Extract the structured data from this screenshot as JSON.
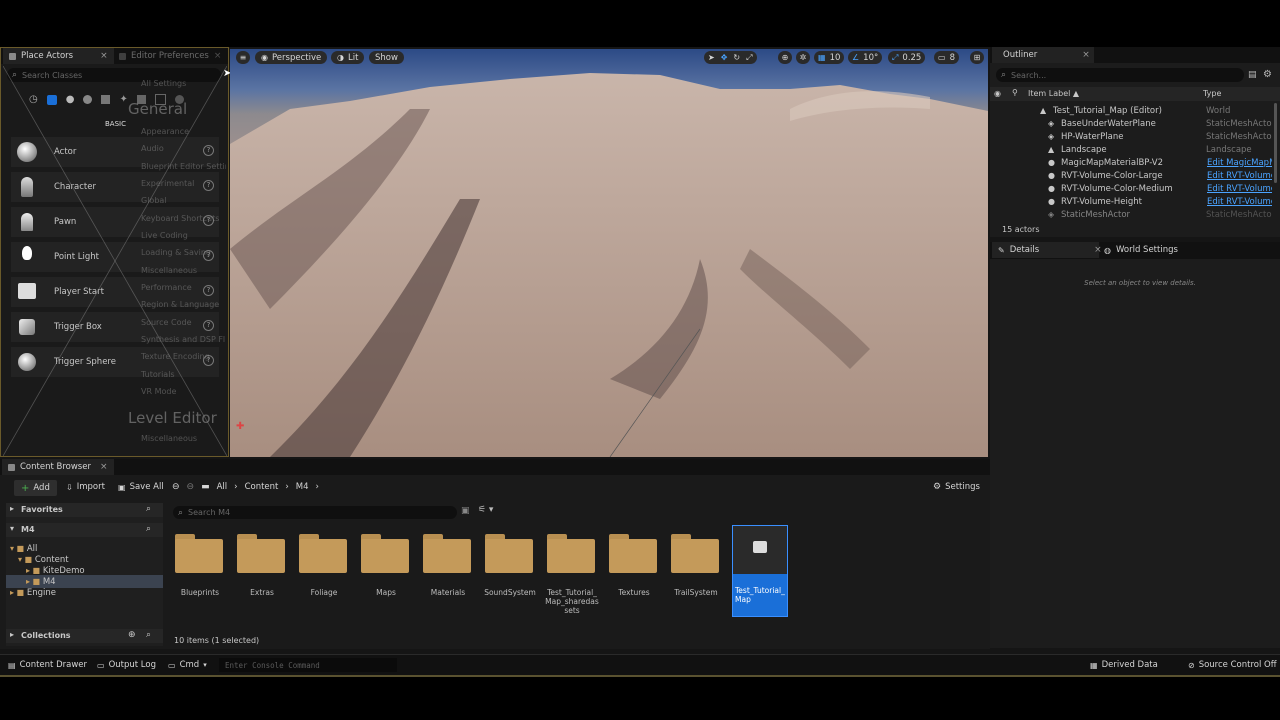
{
  "place_actors": {
    "tab_label": "Place Actors",
    "search_placeholder": "Search Classes",
    "category_label": "BASIC",
    "items": [
      {
        "label": "Actor"
      },
      {
        "label": "Character"
      },
      {
        "label": "Pawn"
      },
      {
        "label": "Point Light"
      },
      {
        "label": "Player Start"
      },
      {
        "label": "Trigger Box"
      },
      {
        "label": "Trigger Sphere"
      }
    ]
  },
  "editor_prefs": {
    "tab_label": "Editor Preferences",
    "all_settings": "All Settings",
    "general_heading": "General",
    "level_editor_heading": "Level Editor",
    "items": [
      "Appearance",
      "Audio",
      "Blueprint Editor Settings",
      "Experimental",
      "Global",
      "Keyboard Shortcuts",
      "Live Coding",
      "Loading & Saving",
      "Miscellaneous",
      "Performance",
      "Region & Language",
      "Source Code",
      "Synthesis and DSP Fl",
      "Texture Encoding",
      "Tutorials",
      "VR Mode"
    ],
    "misc": "Miscellaneous"
  },
  "viewport": {
    "perspective": "Perspective",
    "lit": "Lit",
    "show": "Show",
    "grid_size": "10",
    "angle": "10°",
    "scale": "0.25",
    "camera_speed": "8"
  },
  "outliner": {
    "tab_label": "Outliner",
    "search_placeholder": "Search...",
    "col_item_label": "Item Label ▲",
    "col_type": "Type",
    "rows": [
      {
        "label": "Test_Tutorial_Map (Editor)",
        "type": "World",
        "link": false
      },
      {
        "label": "BaseUnderWaterPlane",
        "type": "StaticMeshActor",
        "link": false
      },
      {
        "label": "HP-WaterPlane",
        "type": "StaticMeshActor",
        "link": false
      },
      {
        "label": "Landscape",
        "type": "Landscape",
        "link": false
      },
      {
        "label": "MagicMapMaterialBP-V2",
        "type": "Edit MagicMapM",
        "link": true
      },
      {
        "label": "RVT-Volume-Color-Large",
        "type": "Edit RVT-Volume",
        "link": true
      },
      {
        "label": "RVT-Volume-Color-Medium",
        "type": "Edit RVT-Volume",
        "link": true
      },
      {
        "label": "RVT-Volume-Height",
        "type": "Edit RVT-Volume",
        "link": true
      },
      {
        "label": "StaticMeshActor",
        "type": "StaticMeshActor",
        "link": false
      }
    ],
    "actor_count": "15 actors"
  },
  "details": {
    "tab_label": "Details",
    "world_settings_label": "World Settings",
    "empty_message": "Select an object to view details."
  },
  "content_browser": {
    "tab_label": "Content Browser",
    "add": "Add",
    "import": "Import",
    "save_all": "Save All",
    "breadcrumb": [
      "All",
      "Content",
      "M4"
    ],
    "settings": "Settings",
    "favorites": "Favorites",
    "m4_header": "M4",
    "tree": [
      "All",
      "Content",
      "KiteDemo",
      "M4",
      "Engine"
    ],
    "collections": "Collections",
    "search_placeholder": "Search M4",
    "folders": [
      "Blueprints",
      "Extras",
      "Foliage",
      "Maps",
      "Materials",
      "SoundSystem",
      "Test_Tutorial_Map_sharedassets",
      "Textures",
      "TrailSystem"
    ],
    "selected_asset": "Test_Tutorial_Map",
    "status": "10 items (1 selected)"
  },
  "statusbar": {
    "content_drawer": "Content Drawer",
    "output_log": "Output Log",
    "cmd": "Cmd",
    "console_placeholder": "Enter Console Command",
    "derived_data": "Derived Data",
    "source_control": "Source Control Off"
  },
  "colors": {
    "accent_blue": "#1a6fd8",
    "link_blue": "#4aa3ff",
    "folder": "#c49a5a",
    "panel": "#1c1c1c",
    "border_gold": "#5a5230"
  }
}
